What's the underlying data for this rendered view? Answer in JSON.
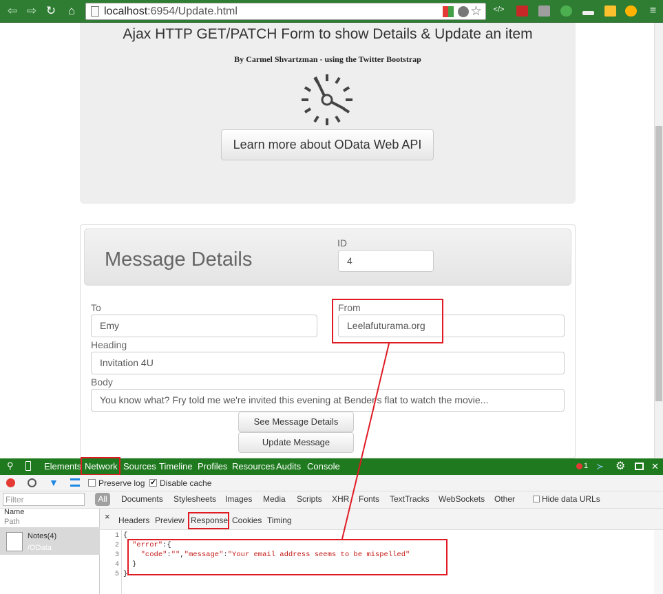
{
  "browser": {
    "url_host": "localhost",
    "url_rest": ":6954/Update.html"
  },
  "jumbotron": {
    "title": "Ajax HTTP GET/PATCH Form to show Details & Update an item",
    "byline": "By Carmel Shvartzman - using the Twitter Bootstrap",
    "learn_button": "Learn more about OData Web API"
  },
  "form": {
    "panel_title": "Message Details",
    "id_label": "ID",
    "id_value": "4",
    "to_label": "To",
    "to_value": "Emy",
    "from_label": "From",
    "from_value": "Leelafuturama.org",
    "heading_label": "Heading",
    "heading_value": "Invitation 4U",
    "body_label": "Body",
    "body_value": "You know what? Fry told me we're invited this evening at Bender's flat to watch the movie...",
    "see_button": "See Message Details",
    "update_button": "Update Message"
  },
  "devtools": {
    "tabs": [
      "Elements",
      "Network",
      "Sources",
      "Timeline",
      "Profiles",
      "Resources",
      "Audits",
      "Console"
    ],
    "active_tab": "Network",
    "error_count": "1",
    "preserve_log": "Preserve log",
    "disable_cache": "Disable cache",
    "filter_placeholder": "Filter",
    "filters": [
      "All",
      "Documents",
      "Stylesheets",
      "Images",
      "Media",
      "Scripts",
      "XHR",
      "Fonts",
      "TextTracks",
      "WebSockets",
      "Other"
    ],
    "hide_data_urls": "Hide data URLs",
    "col_name": "Name",
    "col_path": "Path",
    "request_name": "Notes(4)",
    "request_path": "/OData",
    "detail_tabs": [
      "Headers",
      "Preview",
      "Response",
      "Cookies",
      "Timing"
    ],
    "active_detail_tab": "Response",
    "line_numbers": [
      "1",
      "2",
      "3",
      "4",
      "5"
    ],
    "response": {
      "l1": "{",
      "l2_key": "\"error\"",
      "l2_rest": ":{",
      "l3_indent": "  ",
      "l3_code_key": "\"code\"",
      "l3_colon1": ":",
      "l3_code_val": "\"\"",
      "l3_comma": ",",
      "l3_msg_key": "\"message\"",
      "l3_colon2": ":",
      "l3_msg_val": "\"Your email address seems to be mispelled\"",
      "l4": "}",
      "l5": "}"
    }
  },
  "colors": {
    "chrome_green": "#2e7d32",
    "devtools_green": "#1f7a1f",
    "annotation_red": "#e01b24"
  }
}
